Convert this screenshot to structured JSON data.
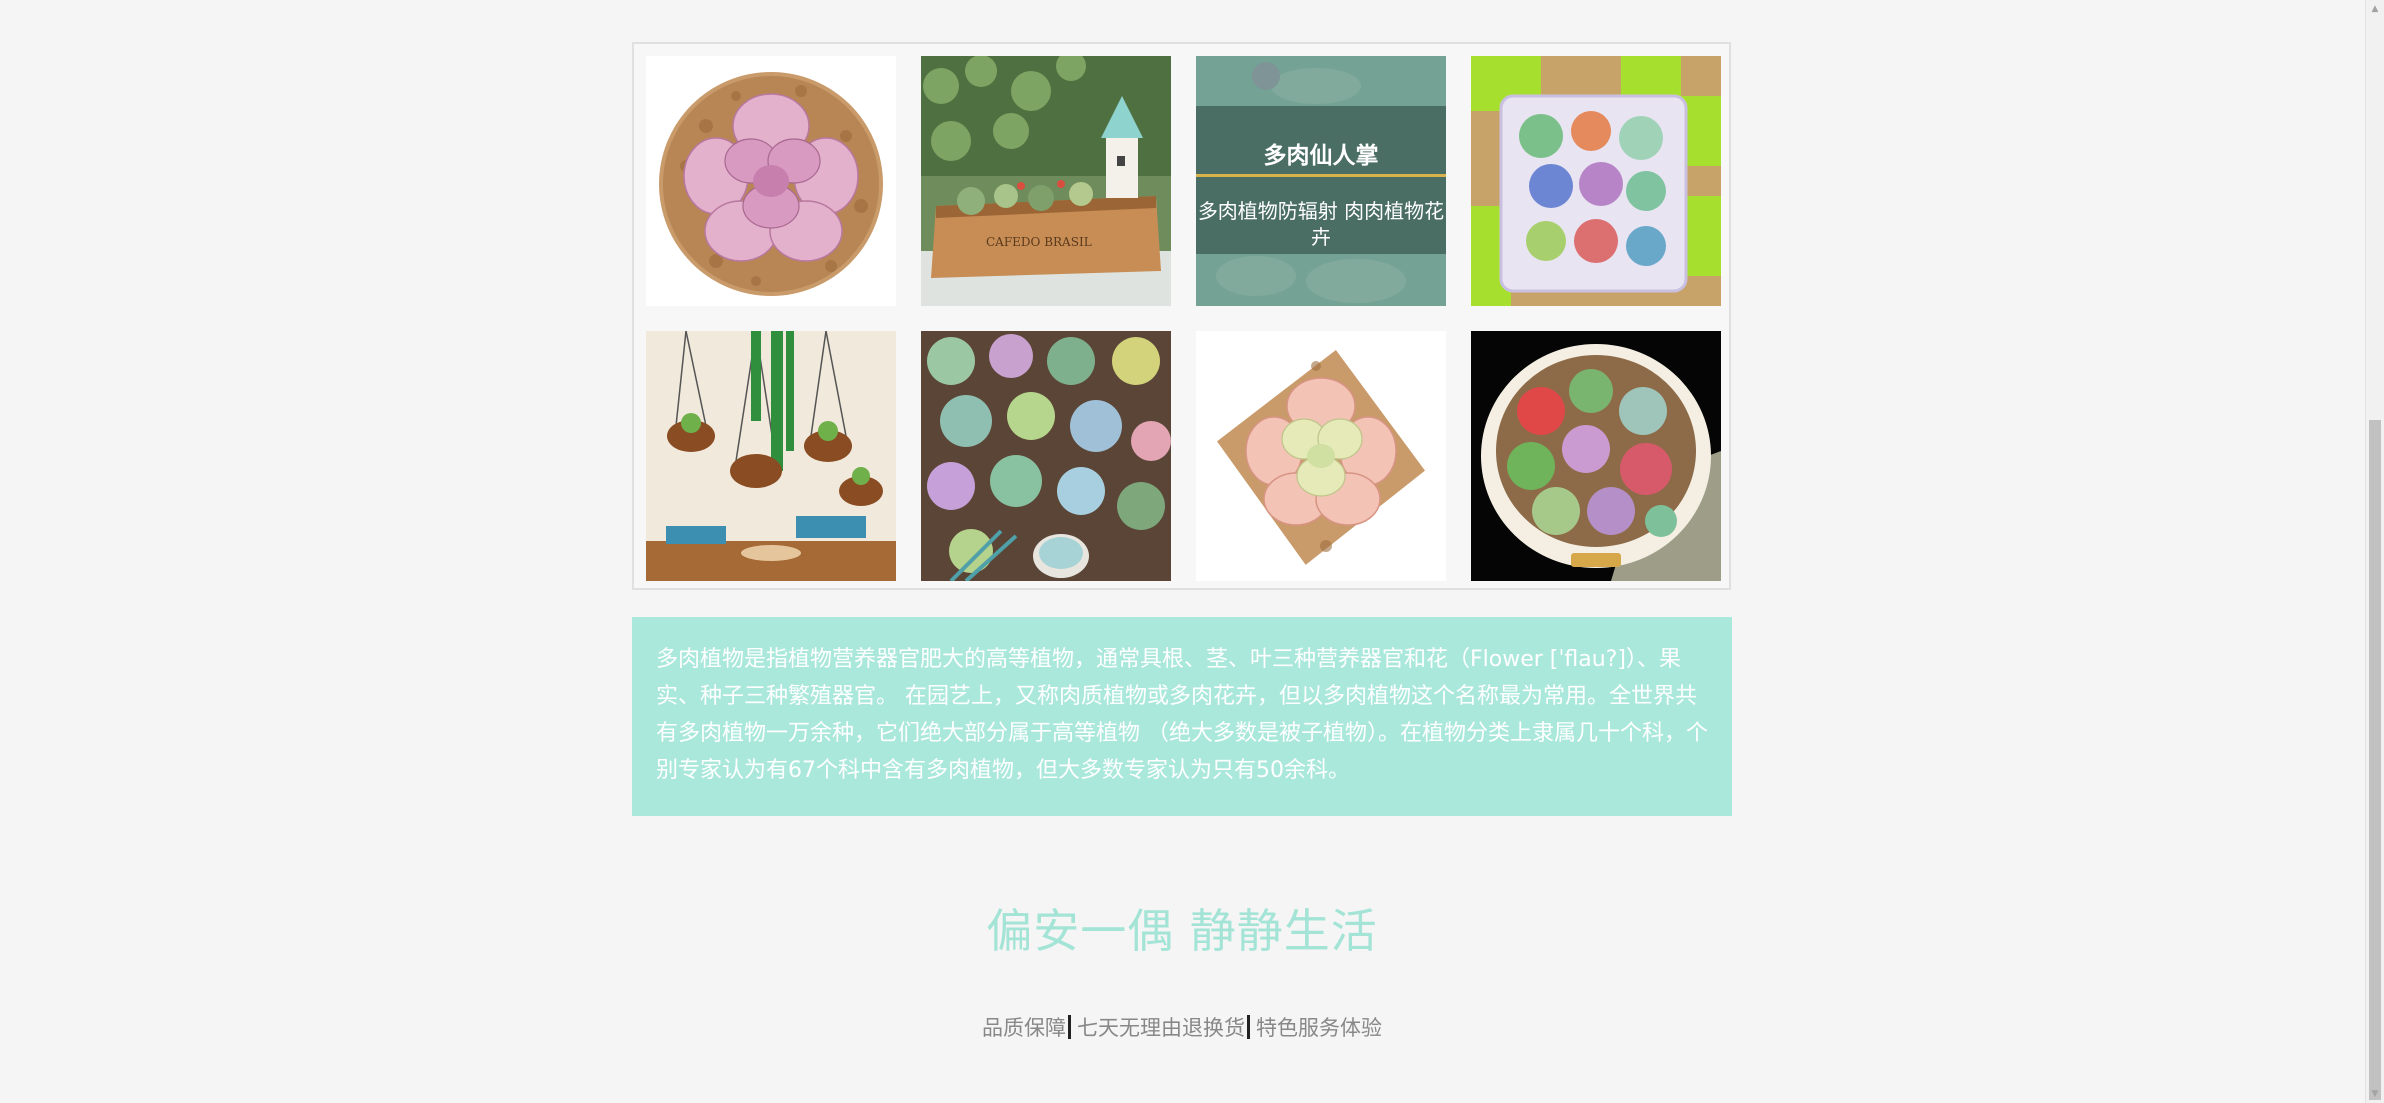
{
  "gallery": {
    "items": [
      {
        "name": "pink-succulent-pot",
        "alt": ""
      },
      {
        "name": "wooden-planter-garden",
        "alt": ""
      },
      {
        "name": "succulent-hover-card",
        "overlay_title": "多肉仙人掌",
        "overlay_subtitle": "多肉植物防辐射 肉肉植物花卉"
      },
      {
        "name": "green-pots-colorful-succulents",
        "alt": ""
      },
      {
        "name": "hanging-copper-pots",
        "alt": ""
      },
      {
        "name": "succulent-collection-topdown",
        "alt": ""
      },
      {
        "name": "peach-succulent-pot",
        "alt": ""
      },
      {
        "name": "round-bowl-succulents",
        "alt": ""
      }
    ]
  },
  "description": {
    "text": "多肉植物是指植物营养器官肥大的高等植物，通常具根、茎、叶三种营养器官和花（Flower [ˈflau?]）、果实、种子三种繁殖器官。 在园艺上，又称肉质植物或多肉花卉，但以多肉植物这个名称最为常用。全世界共有多肉植物一万余种，它们绝大部分属于高等植物 （绝大多数是被子植物）。在植物分类上隶属几十个科，个别专家认为有67个科中含有多肉植物，但大多数专家认为只有50余科。"
  },
  "slogan": "偏安一偶 静静生活",
  "footer": {
    "links": [
      "品质保障",
      "七天无理由退换货",
      "特色服务体验"
    ]
  },
  "colors": {
    "accent": "#abe8dc",
    "slogan": "#a4e4d6",
    "overlay_line": "#d8b24a",
    "page_bg": "#f5f5f5"
  }
}
